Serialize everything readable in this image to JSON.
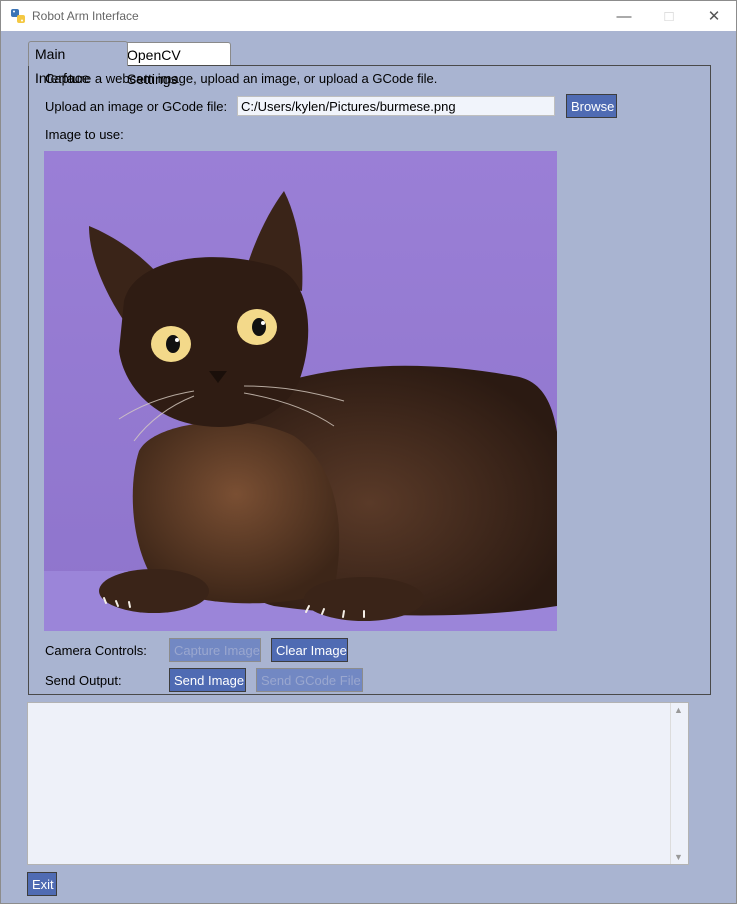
{
  "window": {
    "title": "Robot Arm Interface"
  },
  "tabs": [
    {
      "label": "Main Interface"
    },
    {
      "label": "OpenCV Settings"
    }
  ],
  "main": {
    "intro": "Capture a webcam image, upload an image, or upload a GCode file.",
    "upload_label": "Upload an image or GCode file:",
    "upload_value": "C:/Users/kylen/Pictures/burmese.png",
    "browse_label": "Browse",
    "image_label": "Image to use:",
    "camera_label": "Camera Controls:",
    "capture_label": "Capture Image",
    "clear_label": "Clear Image",
    "send_label": "Send Output:",
    "send_image_label": "Send Image",
    "send_gcode_label": "Send GCode File"
  },
  "output": {
    "text": ""
  },
  "exit_label": "Exit",
  "colors": {
    "window_bg": "#a9b4d1",
    "button_bg": "#4f6bb3",
    "button_disabled_bg": "#7288c3",
    "photo_bg": "#9a7fd6"
  },
  "icons": {
    "app": "python-icon",
    "minimize": "minimize-icon",
    "maximize": "maximize-icon",
    "close": "close-icon"
  }
}
